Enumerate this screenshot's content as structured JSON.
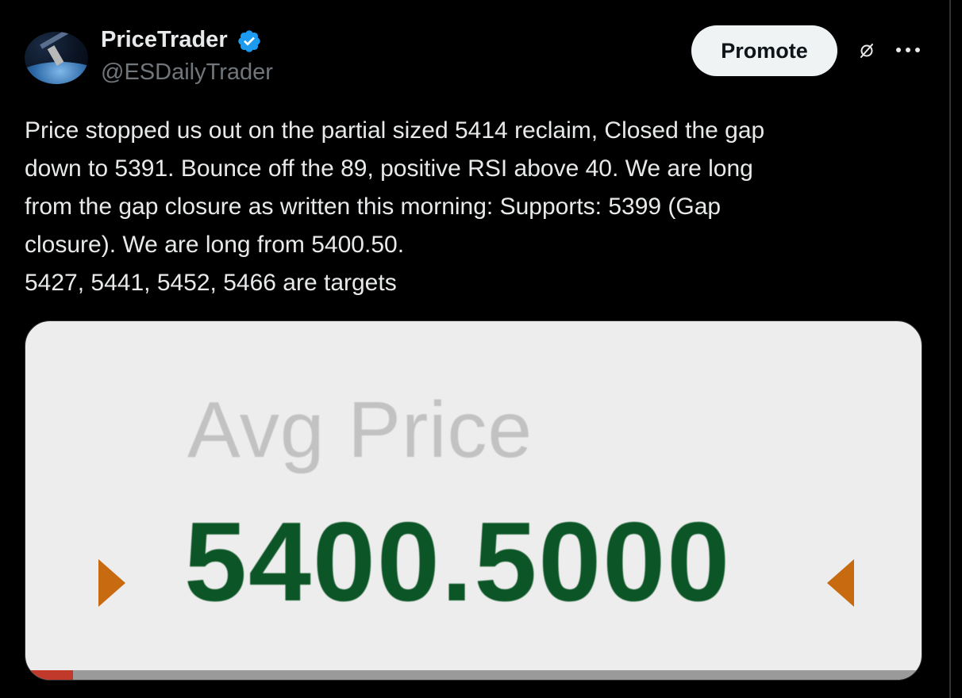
{
  "author": {
    "display_name": "PriceTrader",
    "handle": "@ESDailyTrader",
    "verified": true,
    "verified_color": "#1d9bf0",
    "avatar_icon": "satellite-over-earth-avatar"
  },
  "actions": {
    "promote_label": "Promote",
    "grok_icon": "grok-icon",
    "more_icon": "more-options-icon"
  },
  "post": {
    "lines": [
      "Price stopped us out on the partial sized 5414 reclaim, Closed the gap",
      "down to 5391. Bounce off the 89, positive RSI above 40. We are long",
      "from the gap closure as written this morning: Supports: 5399 (Gap",
      "closure). We are long from 5400.50.",
      "5427, 5441, 5452, 5466 are targets"
    ]
  },
  "media": {
    "label": "Avg Price",
    "value": "5400.5000",
    "value_color": "#0c5526",
    "label_color": "#c2c2c2",
    "arrow_color": "#c86a10"
  },
  "colors": {
    "background": "#000000",
    "text_primary": "#e7e9ea",
    "text_secondary": "#71767b",
    "button_bg": "#eff3f4"
  }
}
